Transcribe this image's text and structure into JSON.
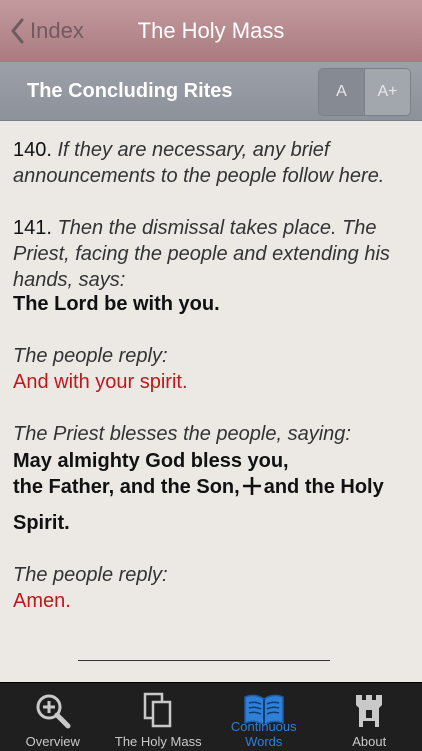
{
  "nav": {
    "back_label": "Index",
    "title": "The Holy Mass"
  },
  "section": {
    "title": "The Concluding Rites",
    "font_small_label": "A",
    "font_large_label": "A+"
  },
  "content": {
    "p140_num": "140.",
    "p140_text": "If they are necessary, any brief announcements to the people follow here.",
    "p141_num": "141.",
    "p141_text": "Then the dismissal takes place. The Priest, facing the people and extending his hands, says:",
    "priest_line1": "The Lord be with you.",
    "rubric1": "The people reply:",
    "response1": "And with your spirit.",
    "rubric2": "The Priest blesses the people, saying:",
    "blessing_line1": "May almighty God bless you,",
    "blessing_line2a": "the Father, and the Son,",
    "blessing_line2b": "and the Holy",
    "blessing_line3": "Spirit.",
    "rubric3": "The people reply:",
    "response2": "Amen."
  },
  "tabs": [
    {
      "label": "Overview",
      "icon": "magnifier-plus-icon"
    },
    {
      "label": "The Holy Mass",
      "icon": "pages-icon"
    },
    {
      "label": "Continuous Words",
      "icon": "open-book-icon"
    },
    {
      "label": "About",
      "icon": "castle-icon"
    }
  ],
  "colors": {
    "nav_bar": "#b58a8f",
    "section_bar": "#959aa2",
    "response_red": "#c0171a",
    "tab_active": "#2f7fd6"
  }
}
